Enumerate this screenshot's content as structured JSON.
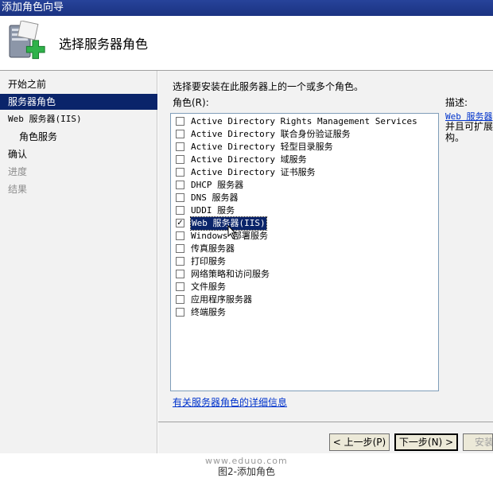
{
  "window": {
    "title": "添加角色向导"
  },
  "header": {
    "title": "选择服务器角色",
    "icon": "server-add-icon"
  },
  "sidebar": {
    "steps": [
      {
        "label": "开始之前",
        "state": "normal"
      },
      {
        "label": "服务器角色",
        "state": "active"
      },
      {
        "label": "Web 服务器(IIS)",
        "state": "normal"
      },
      {
        "label": "角色服务",
        "state": "normal"
      },
      {
        "label": "确认",
        "state": "normal"
      },
      {
        "label": "进度",
        "state": "disabled"
      },
      {
        "label": "结果",
        "state": "disabled"
      }
    ]
  },
  "main": {
    "instruction": "选择要安装在此服务器上的一个或多个角色。",
    "roles_label": "角色(R):",
    "roles": [
      {
        "label": "Active Directory Rights Management Services",
        "checked": false
      },
      {
        "label": "Active Directory 联合身份验证服务",
        "checked": false
      },
      {
        "label": "Active Directory 轻型目录服务",
        "checked": false
      },
      {
        "label": "Active Directory 域服务",
        "checked": false
      },
      {
        "label": "Active Directory 证书服务",
        "checked": false
      },
      {
        "label": "DHCP 服务器",
        "checked": false
      },
      {
        "label": "DNS 服务器",
        "checked": false
      },
      {
        "label": "UDDI 服务",
        "checked": false
      },
      {
        "label": "Web 服务器(IIS)",
        "checked": true,
        "selected": true
      },
      {
        "label": "Windows 部署服务",
        "checked": false
      },
      {
        "label": "传真服务器",
        "checked": false
      },
      {
        "label": "打印服务",
        "checked": false
      },
      {
        "label": "网络策略和访问服务",
        "checked": false
      },
      {
        "label": "文件服务",
        "checked": false
      },
      {
        "label": "应用程序服务器",
        "checked": false
      },
      {
        "label": "终端服务",
        "checked": false
      }
    ],
    "more_info_link": "有关服务器角色的详细信息",
    "description": {
      "label": "描述:",
      "link": "Web 服务器",
      "text": "并且可扩展构。"
    }
  },
  "buttons": {
    "back": "< 上一步(P)",
    "next": "下一步(N) >",
    "install": "安装"
  },
  "footer": {
    "watermark": "www.eduuo.com",
    "caption": "图2-添加角色"
  },
  "colors": {
    "titlebar": "#1a3281",
    "selection": "#0a246a",
    "link": "#0033cc",
    "panel": "#f2f2f2"
  }
}
